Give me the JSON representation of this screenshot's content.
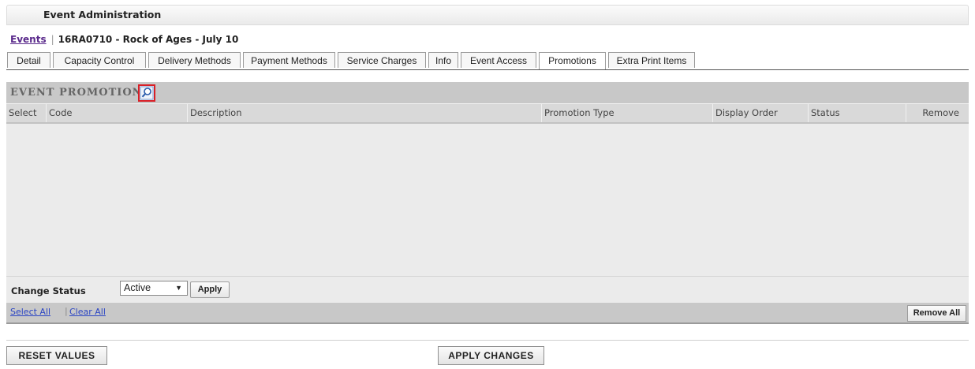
{
  "header": {
    "title": "Event Administration"
  },
  "breadcrumb": {
    "link": "Events",
    "separator": "|",
    "current": "16RA0710 - Rock of Ages - July 10"
  },
  "tabs": [
    {
      "label": "Detail"
    },
    {
      "label": "Capacity Control"
    },
    {
      "label": "Delivery Methods"
    },
    {
      "label": "Payment Methods"
    },
    {
      "label": "Service Charges"
    },
    {
      "label": "Info"
    },
    {
      "label": "Event Access"
    },
    {
      "label": "Promotions",
      "active": true
    },
    {
      "label": "Extra Print Items"
    }
  ],
  "section": {
    "title": "EVENT PROMOTIONS",
    "zoom_icon": "magnifier-icon",
    "highlight_color": "#d91f26"
  },
  "columns": [
    "Select",
    "Code",
    "Description",
    "Promotion Type",
    "Display Order",
    "Status",
    "Remove"
  ],
  "rows": [],
  "status_bar": {
    "label": "Change Status",
    "selected": "Active",
    "apply_label": "Apply"
  },
  "footer": {
    "select_all": "Select All",
    "separator": "|",
    "clear_all": "Clear All",
    "remove_all": "Remove All"
  },
  "actions": {
    "reset": "RESET VALUES",
    "apply": "APPLY CHANGES"
  }
}
